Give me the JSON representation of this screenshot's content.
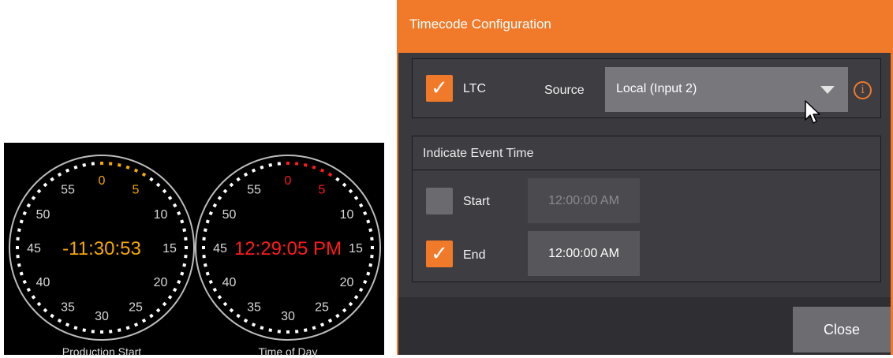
{
  "clocks": [
    {
      "id": "production-start",
      "caption": "Production Start",
      "time": "-11:30:53",
      "color": "#f5a800",
      "dial_labels": [
        "0",
        "5",
        "10",
        "15",
        "20",
        "25",
        "30",
        "35",
        "40",
        "45",
        "50",
        "55"
      ]
    },
    {
      "id": "time-of-day",
      "caption": "Time of Day",
      "time": "12:29:05 PM",
      "color": "#ff1a1a",
      "dial_labels": [
        "0",
        "5",
        "10",
        "15",
        "20",
        "25",
        "30",
        "35",
        "40",
        "45",
        "50",
        "55"
      ]
    }
  ],
  "dialog": {
    "title": "Timecode Configuration",
    "ltc": {
      "label": "LTC",
      "checked": true,
      "source_label": "Source",
      "source_value": "Local (Input 2)",
      "info_glyph": "i"
    },
    "event_time": {
      "title": "Indicate Event Time",
      "start": {
        "label": "Start",
        "checked": false,
        "time": "12:00:00 AM"
      },
      "end": {
        "label": "End",
        "checked": true,
        "time": "12:00:00 AM"
      }
    },
    "close_label": "Close",
    "check_glyph": "✓"
  },
  "colors": {
    "accent": "#f07a2a",
    "dialog_bg": "#3a3a3e",
    "clock_bg": "#000000"
  },
  "icons": [
    "check-icon",
    "info-icon",
    "dropdown-caret-icon",
    "mouse-cursor-icon"
  ]
}
